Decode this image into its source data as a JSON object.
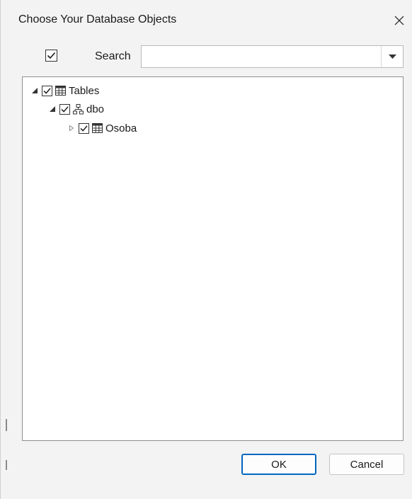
{
  "dialog": {
    "title": "Choose Your Database Objects",
    "close_icon": "close-icon"
  },
  "toolbar": {
    "select_all_checked": true,
    "search_label": "Search",
    "search_value": "",
    "dropdown_icon": "chevron-down-icon"
  },
  "tree": {
    "nodes": [
      {
        "label": "Tables",
        "icon": "table-icon",
        "checked": true,
        "expanded": true,
        "level": 0
      },
      {
        "label": "dbo",
        "icon": "schema-icon",
        "checked": true,
        "expanded": true,
        "level": 1
      },
      {
        "label": "Osoba",
        "icon": "table-icon",
        "checked": true,
        "expanded": false,
        "level": 2
      }
    ]
  },
  "buttons": {
    "ok_label": "OK",
    "cancel_label": "Cancel"
  },
  "colors": {
    "accent": "#0067c0",
    "background": "#f3f3f3",
    "panel": "#ffffff"
  }
}
